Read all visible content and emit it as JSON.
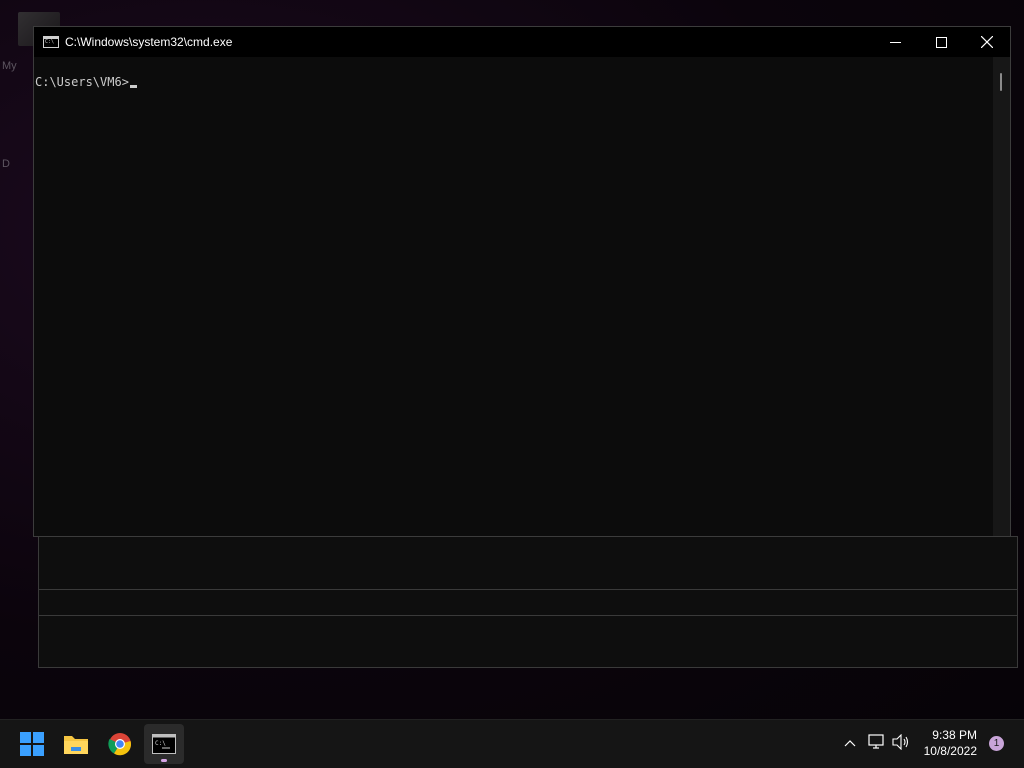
{
  "window": {
    "title": "C:\\Windows\\system32\\cmd.exe",
    "controls": {
      "minimize": "—",
      "maximize": "☐",
      "close": "✕"
    }
  },
  "console": {
    "prompt": "C:\\Users\\VM6>"
  },
  "desktop": {
    "labels": [
      "My",
      "D"
    ]
  },
  "taskbar": {
    "clock_time": "9:38 PM",
    "clock_date": "10/8/2022",
    "notification_count": "1",
    "apps": [
      "start-menu",
      "file-explorer",
      "chrome",
      "command-prompt"
    ],
    "active_app": "command-prompt"
  },
  "colors": {
    "accent": "#d7a6e6",
    "console_bg": "#0c0c0c",
    "console_text": "#cccccc"
  }
}
